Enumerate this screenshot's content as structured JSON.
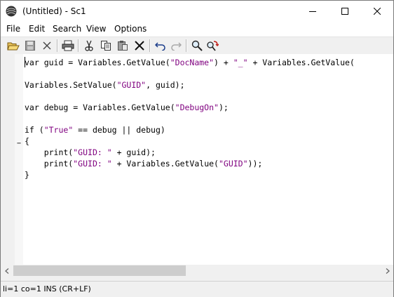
{
  "window": {
    "title": "(Untitled) - Sc1",
    "controls": [
      "minimize",
      "maximize",
      "close"
    ]
  },
  "menu": {
    "items": [
      "File",
      "Edit",
      "Search",
      "View",
      "Options"
    ]
  },
  "toolbar": {
    "buttons": [
      "open-icon",
      "save-icon",
      "close-file-icon",
      "print-icon",
      "cut-icon",
      "copy-icon",
      "paste-icon",
      "delete-icon",
      "undo-icon",
      "redo-icon",
      "find-icon",
      "replace-icon"
    ]
  },
  "editor": {
    "fold_marker": "−",
    "lines": [
      [
        {
          "t": "var guid = Variables.GetValue("
        },
        {
          "s": "\"DocName\""
        },
        {
          "t": ") + "
        },
        {
          "s": "\"_\""
        },
        {
          "t": " + Variables.GetValue("
        }
      ],
      [
        {
          "t": ""
        }
      ],
      [
        {
          "t": "Variables.SetValue("
        },
        {
          "s": "\"GUID\""
        },
        {
          "t": ", guid);"
        }
      ],
      [
        {
          "t": ""
        }
      ],
      [
        {
          "t": "var debug = Variables.GetValue("
        },
        {
          "s": "\"DebugOn\""
        },
        {
          "t": ");"
        }
      ],
      [
        {
          "t": ""
        }
      ],
      [
        {
          "t": "if ("
        },
        {
          "s": "\"True\""
        },
        {
          "t": " == debug || debug)"
        }
      ],
      [
        {
          "t": "{"
        }
      ],
      [
        {
          "t": "    print("
        },
        {
          "s": "\"GUID: \""
        },
        {
          "t": " + guid);"
        }
      ],
      [
        {
          "t": "    print("
        },
        {
          "s": "\"GUID: \""
        },
        {
          "t": " + Variables.GetValue("
        },
        {
          "s": "\"GUID\""
        },
        {
          "t": "));"
        }
      ],
      [
        {
          "t": "}"
        }
      ]
    ]
  },
  "colors": {
    "string": "#7f007f",
    "text": "#000000"
  },
  "status": {
    "text": "li=1 co=1 INS (CR+LF)"
  }
}
